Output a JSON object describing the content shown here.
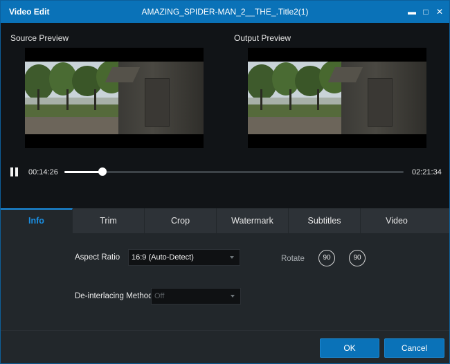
{
  "window": {
    "title": "Video Edit",
    "file_title": "AMAZING_SPIDER-MAN_2__THE_.Title2(1)",
    "minimize_glyph": "▬",
    "maximize_glyph": "□",
    "close_glyph": "✕"
  },
  "preview": {
    "source_label": "Source Preview",
    "output_label": "Output Preview"
  },
  "playback": {
    "current_time": "00:14:26",
    "total_time": "02:21:34",
    "progress_fraction": 0.113
  },
  "tabs": [
    "Info",
    "Trim",
    "Crop",
    "Watermark",
    "Subtitles",
    "Video"
  ],
  "active_tab": "Info",
  "info": {
    "aspect_ratio_label": "Aspect Ratio",
    "aspect_ratio_value": "16:9 (Auto-Detect)",
    "deinterlacing_label": "De-interlacing Method",
    "deinterlacing_value": "Off",
    "rotate_label": "Rotate",
    "rotate_left_value": "90",
    "rotate_right_value": "90"
  },
  "buttons": {
    "ok": "OK",
    "cancel": "Cancel"
  },
  "colors": {
    "title_bar": "#0a72b8",
    "accent": "#1a8fe3",
    "button": "#0a72b8"
  }
}
